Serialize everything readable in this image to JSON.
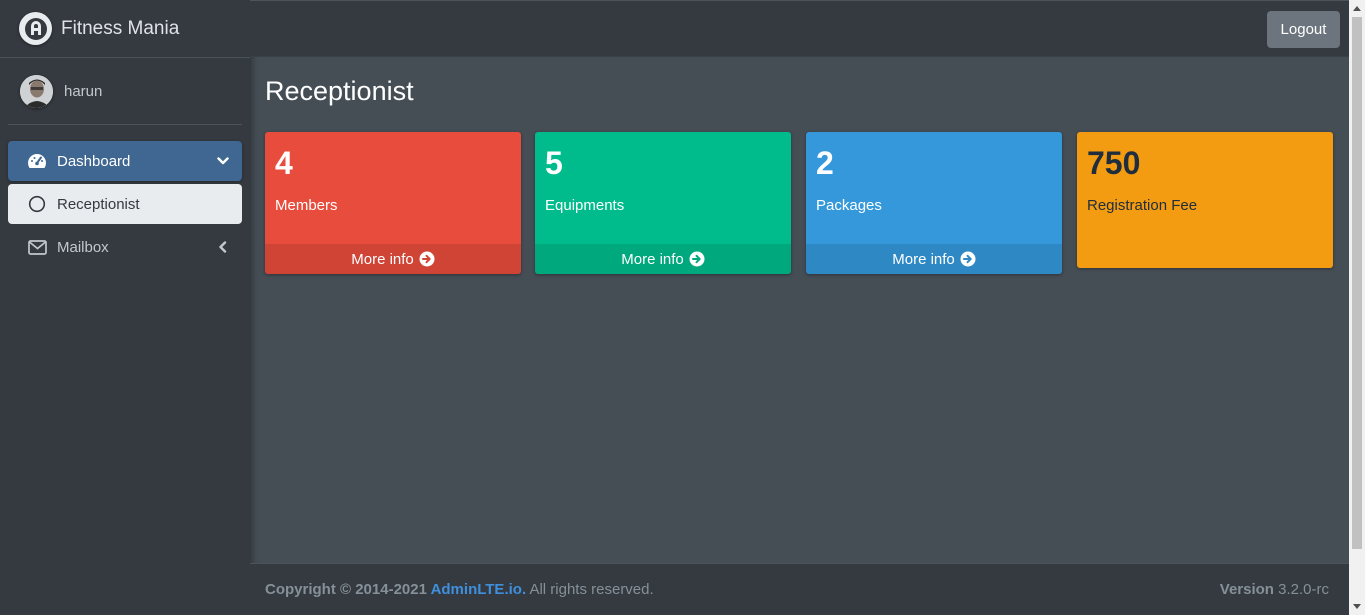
{
  "brand": {
    "name": "Fitness Mania",
    "logo_icon": "adminlte-logo-icon"
  },
  "user": {
    "name": "harun",
    "avatar_icon": "user-avatar"
  },
  "sidebar": {
    "items": [
      {
        "label": "Dashboard",
        "icon": "tachometer-icon",
        "caret": "chevron-down-icon"
      },
      {
        "label": "Receptionist",
        "icon": "circle-outline-icon"
      },
      {
        "label": "Mailbox",
        "icon": "envelope-icon",
        "caret": "chevron-left-icon"
      }
    ]
  },
  "navbar": {
    "logout_label": "Logout"
  },
  "main": {
    "title": "Receptionist",
    "boxes": [
      {
        "value": "4",
        "label": "Members",
        "footer": "More info",
        "color": "#e74c3c"
      },
      {
        "value": "5",
        "label": "Equipments",
        "footer": "More info",
        "color": "#00bc8c"
      },
      {
        "value": "2",
        "label": "Packages",
        "footer": "More info",
        "color": "#3498db"
      },
      {
        "value": "750",
        "label": "Registration Fee",
        "color": "#f39c12"
      }
    ]
  },
  "footer": {
    "copyright_prefix": "Copyright © 2014-2021 ",
    "link_text": "AdminLTE.io.",
    "rights": " All rights reserved.",
    "version_label": "Version",
    "version_value": " 3.2.0-rc"
  }
}
